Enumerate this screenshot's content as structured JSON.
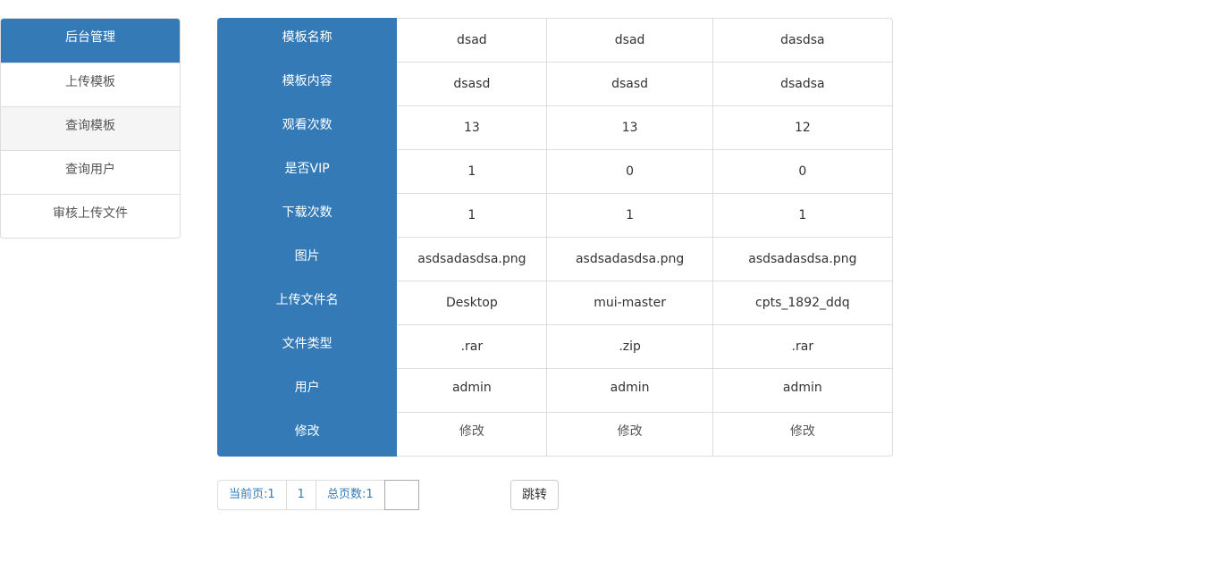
{
  "sidebar": {
    "items": [
      {
        "label": "后台管理"
      },
      {
        "label": "上传模板"
      },
      {
        "label": "查询模板"
      },
      {
        "label": "查询用户"
      },
      {
        "label": "审核上传文件"
      }
    ]
  },
  "table": {
    "rows": [
      {
        "header": "模板名称",
        "cells": [
          "dsad",
          "dsad",
          "dasdsa"
        ]
      },
      {
        "header": "模板内容",
        "cells": [
          "dsasd",
          "dsasd",
          "dsadsa"
        ]
      },
      {
        "header": "观看次数",
        "cells": [
          "13",
          "13",
          "12"
        ]
      },
      {
        "header": "是否VIP",
        "cells": [
          "1",
          "0",
          "0"
        ]
      },
      {
        "header": "下载次数",
        "cells": [
          "1",
          "1",
          "1"
        ]
      },
      {
        "header": "图片",
        "cells": [
          "asdsadasdsa.png",
          "asdsadasdsa.png",
          "asdsadasdsa.png"
        ]
      },
      {
        "header": "上传文件名",
        "cells": [
          "Desktop",
          "mui-master",
          "cpts_1892_ddq"
        ]
      },
      {
        "header": "文件类型",
        "cells": [
          ".rar",
          ".zip",
          ".rar"
        ]
      },
      {
        "header": "用户",
        "cells": [
          "admin",
          "admin",
          "admin"
        ]
      },
      {
        "header": "修改",
        "cells": [
          "修改",
          "修改",
          "修改"
        ]
      }
    ]
  },
  "pager": {
    "current_label": "当前页:1",
    "page_number": "1",
    "total_label": "总页数:1",
    "page_input_value": ""
  },
  "jump_button": {
    "label": "跳转"
  },
  "colors": {
    "accent": "#337ab7",
    "border": "#dddddd"
  }
}
